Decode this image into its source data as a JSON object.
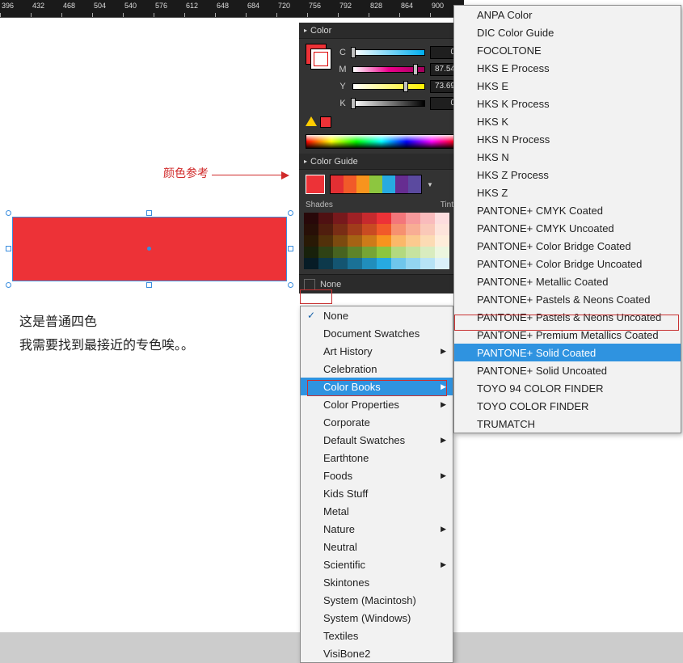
{
  "ruler": {
    "ticks": [
      "396",
      "432",
      "468",
      "504",
      "540",
      "576",
      "612",
      "648",
      "684",
      "720",
      "756",
      "792",
      "828",
      "864",
      "900"
    ]
  },
  "annotation": {
    "label": "颜色参考"
  },
  "canvas_text": {
    "line1": "这是普通四色",
    "line2": "我需要找到最接近的专色唉。。"
  },
  "color_panel": {
    "title": "Color",
    "channels": [
      {
        "label": "C",
        "value": "0"
      },
      {
        "label": "M",
        "value": "87.54"
      },
      {
        "label": "Y",
        "value": "73.69"
      },
      {
        "label": "K",
        "value": "0"
      }
    ]
  },
  "color_guide": {
    "title": "Color Guide",
    "shades_label": "Shades",
    "tints_label": "Tints",
    "footer_label": "None"
  },
  "menu1": {
    "items": [
      {
        "label": "None",
        "checked": true
      },
      {
        "label": "Document Swatches"
      },
      {
        "label": "Art History",
        "submenu": true
      },
      {
        "label": "Celebration"
      },
      {
        "label": "Color Books",
        "submenu": true,
        "highlight": true
      },
      {
        "label": "Color Properties",
        "submenu": true
      },
      {
        "label": "Corporate"
      },
      {
        "label": "Default Swatches",
        "submenu": true
      },
      {
        "label": "Earthtone"
      },
      {
        "label": "Foods",
        "submenu": true
      },
      {
        "label": "Kids Stuff"
      },
      {
        "label": "Metal"
      },
      {
        "label": "Nature",
        "submenu": true
      },
      {
        "label": "Neutral"
      },
      {
        "label": "Scientific",
        "submenu": true
      },
      {
        "label": "Skintones"
      },
      {
        "label": "System (Macintosh)"
      },
      {
        "label": "System (Windows)"
      },
      {
        "label": "Textiles"
      },
      {
        "label": "VisiBone2"
      }
    ]
  },
  "menu2": {
    "items": [
      {
        "label": "ANPA Color"
      },
      {
        "label": "DIC Color Guide"
      },
      {
        "label": "FOCOLTONE"
      },
      {
        "label": "HKS E Process"
      },
      {
        "label": "HKS E"
      },
      {
        "label": "HKS K Process"
      },
      {
        "label": "HKS K"
      },
      {
        "label": "HKS N Process"
      },
      {
        "label": "HKS N"
      },
      {
        "label": "HKS Z Process"
      },
      {
        "label": "HKS Z"
      },
      {
        "label": "PANTONE+ CMYK Coated"
      },
      {
        "label": "PANTONE+ CMYK Uncoated"
      },
      {
        "label": "PANTONE+ Color Bridge Coated"
      },
      {
        "label": "PANTONE+ Color Bridge Uncoated"
      },
      {
        "label": "PANTONE+ Metallic Coated"
      },
      {
        "label": "PANTONE+ Pastels & Neons Coated"
      },
      {
        "label": "PANTONE+ Pastels & Neons Uncoated"
      },
      {
        "label": "PANTONE+ Premium Metallics Coated"
      },
      {
        "label": "PANTONE+ Solid Coated",
        "highlight": true
      },
      {
        "label": "PANTONE+ Solid Uncoated"
      },
      {
        "label": "TOYO 94 COLOR FINDER"
      },
      {
        "label": "TOYO COLOR FINDER"
      },
      {
        "label": "TRUMATCH"
      }
    ]
  },
  "colors": {
    "guide_strip": [
      "#e32f33",
      "#f15a29",
      "#f7941e",
      "#8dc63f",
      "#27aae1",
      "#662d91",
      "#5b4a9f"
    ],
    "guide_grid_base": [
      "#ed3237",
      "#f15a29",
      "#f7941e",
      "#8dc63f",
      "#27aae1",
      "#662d91",
      "#ec008c"
    ]
  }
}
